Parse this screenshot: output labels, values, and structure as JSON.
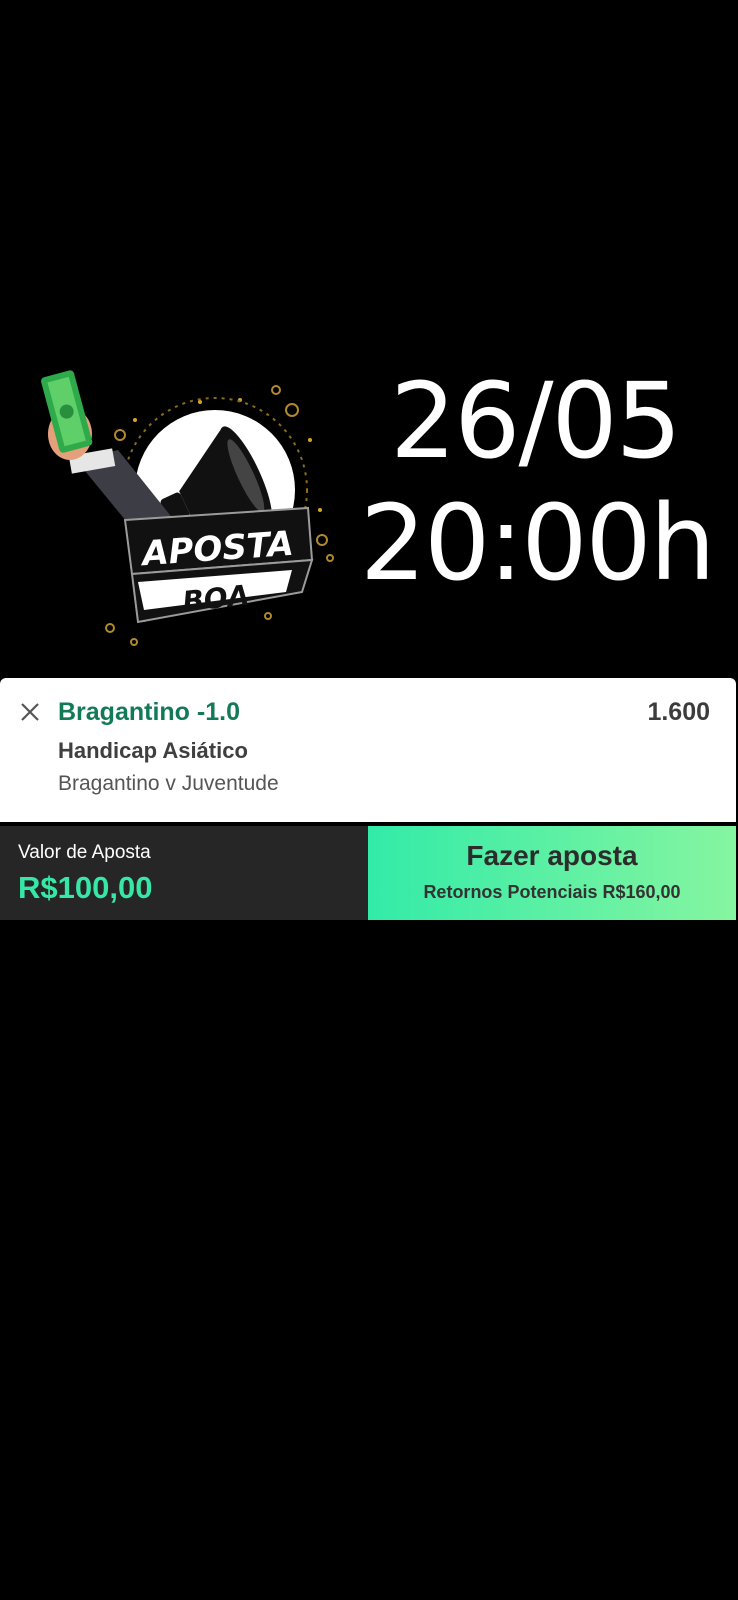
{
  "hero": {
    "logo_line1": "APOSTA",
    "logo_line2": "BOA",
    "date": "26/05",
    "time": "20:00h"
  },
  "bet_slip": {
    "selection": "Bragantino -1.0",
    "odds": "1.600",
    "market": "Handicap Asiático",
    "event": "Bragantino v Juventude"
  },
  "bet_bar": {
    "stake_label": "Valor de Aposta",
    "stake_value": "R$100,00",
    "place_label": "Fazer aposta",
    "returns_label": "Retornos Potenciais R$160,00"
  },
  "colors": {
    "background": "#000000",
    "selection_green": "#137a58",
    "stake_green": "#36e7a6",
    "button_gradient_start": "#32eba8",
    "button_gradient_end": "#86f5a0"
  }
}
